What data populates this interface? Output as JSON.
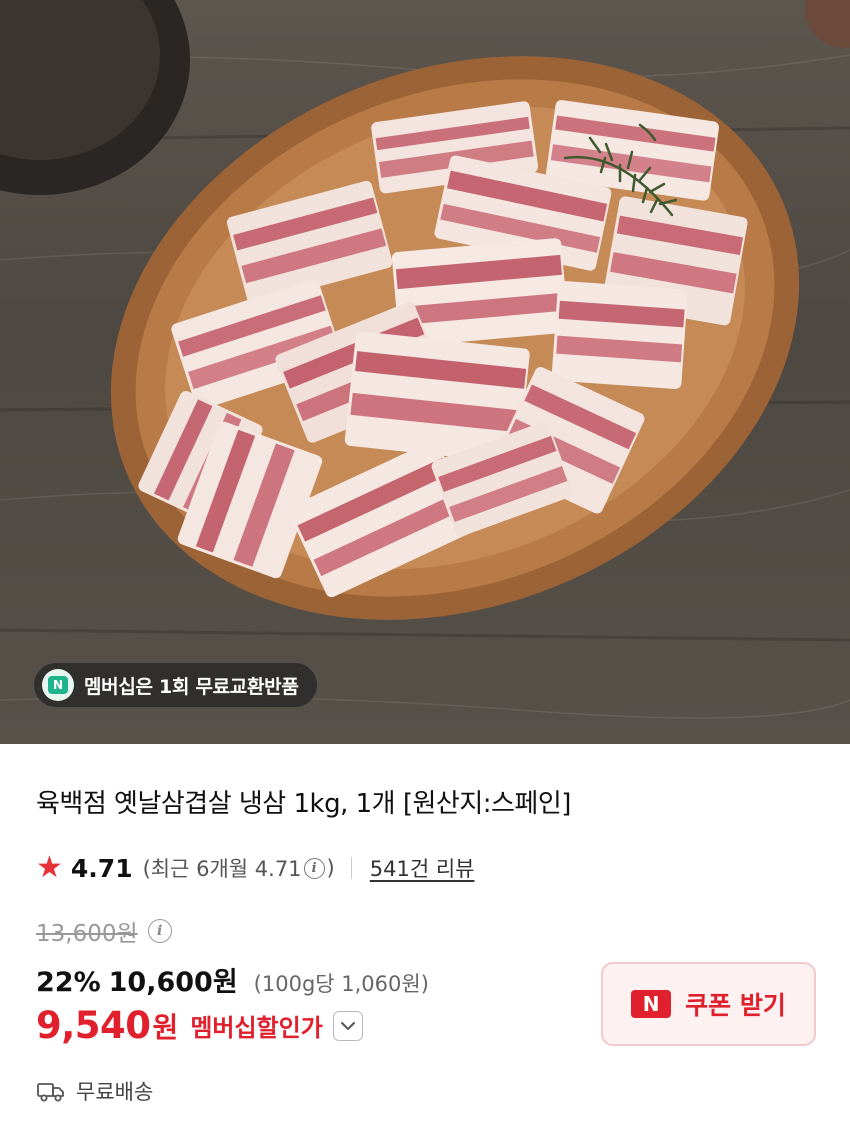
{
  "membership_badge": {
    "icon": "N",
    "text": "멤버십은 1회 무료교환반품"
  },
  "product": {
    "title": "육백점 옛날삼겹살 냉삼 1kg, 1개 [원산지:스페인]",
    "rating": "4.71",
    "rating_recent": "(최근 6개월 4.71",
    "rating_recent_close": ")",
    "review_count": "541건 리뷰"
  },
  "price": {
    "original": "13,600원",
    "discount_rate": "22%",
    "sale": "10,600원",
    "unit_price": "(100g당 1,060원)",
    "member_price": "9,540",
    "member_price_unit": "원",
    "member_label": "멤버십할인가"
  },
  "coupon": {
    "icon": "N",
    "label": "쿠폰 받기"
  },
  "shipping": {
    "label": "무료배송"
  },
  "colors": {
    "accent_red": "#e0202c",
    "coupon_bg": "#fdf1f2",
    "badge_green": "#1fb58c"
  }
}
